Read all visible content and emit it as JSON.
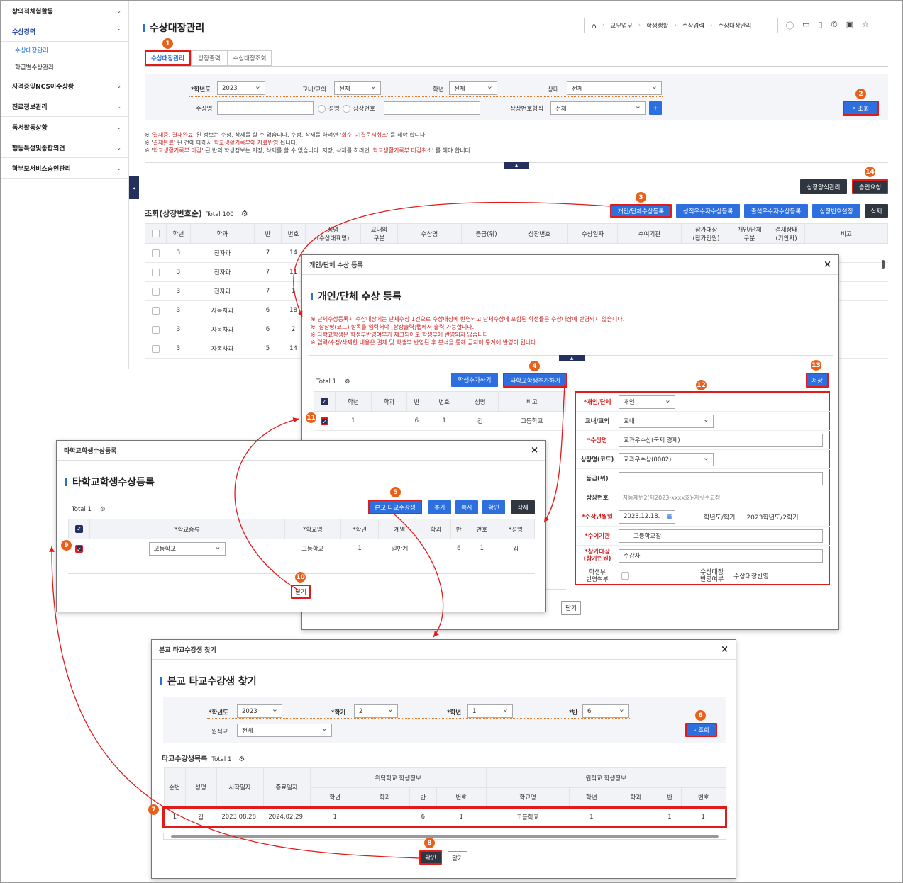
{
  "sidebar": {
    "items": [
      {
        "label": "창의적체험활동"
      },
      {
        "label": "수상경력"
      },
      {
        "label": "자격증및NCS이수상황"
      },
      {
        "label": "진로정보관리"
      },
      {
        "label": "독서활동상황"
      },
      {
        "label": "행동특성및종합의견"
      },
      {
        "label": "학부모서비스승인관리"
      }
    ],
    "subitems": [
      {
        "label": "수상대장관리"
      },
      {
        "label": "학급별수상관리"
      }
    ]
  },
  "header": {
    "title": "수상대장관리",
    "breadcrumb": [
      "교무업무",
      "학생생활",
      "수상경력",
      "수상대장관리"
    ]
  },
  "tabs": [
    {
      "label": "수상대장관리"
    },
    {
      "label": "상장출력"
    },
    {
      "label": "수상대장조회"
    }
  ],
  "search": {
    "year_label": "*학년도",
    "year": "2023",
    "inout_label": "교내/교외",
    "inout": "전체",
    "grade_label": "학년",
    "grade": "전체",
    "status_label": "상태",
    "status": "전체",
    "award_label": "수상명",
    "radio_name": "성명",
    "radio_no": "상장번호",
    "format_label": "상장번호형식",
    "format": "전체",
    "search_btn": "조회",
    "plus": "+"
  },
  "notes": [
    {
      "a": "※ '",
      "b": "결재중, 결재완료",
      "c": "' 된 정보는 수정, 삭제를 할 수 없습니다. 수정, 삭제를 하려면 '",
      "d": "회수, 기결문서취소",
      "e": "' 를 해야 합니다."
    },
    {
      "a": "※ '",
      "b": "결재완료",
      "c": "' 된 건에 대해서 ",
      "d": "학교생활기록부에 자료반영",
      "e": " 됩니다."
    },
    {
      "a": "※ '",
      "b": "학교생활기록부 마감",
      "c": "' 된 반의 학생정보는 저장, 삭제를 할 수 없습니다. 저장, 삭제를 하려면 '",
      "d": "학교생활기록부 마감취소",
      "e": "' 를 해야 합니다."
    }
  ],
  "toolbar": {
    "manage": "상장양식관리",
    "approve": "승인요청",
    "list_title": "조회(상장번호순)",
    "total": "Total 100",
    "b_indiv": "개인/단체수상등록",
    "b_grade": "성적우수자수상등록",
    "b_attend": "출석우수자수상등록",
    "b_num": "상장번호설정",
    "b_del": "삭제"
  },
  "main_table": {
    "headers": [
      "학년",
      "학과",
      "반",
      "번호",
      "성명\n(수상대표명)",
      "교내외\n구분",
      "수상명",
      "등급(위)",
      "상장번호",
      "수상일자",
      "수여기관",
      "참가대상\n(참가인원)",
      "개인/단체\n구분",
      "결재상태\n(기안자)",
      "비고"
    ],
    "rows": [
      [
        "3",
        "전자과",
        "7",
        "14"
      ],
      [
        "3",
        "전자과",
        "7",
        "11"
      ],
      [
        "3",
        "전자과",
        "7",
        "1"
      ],
      [
        "3",
        "자동차과",
        "6",
        "18"
      ],
      [
        "3",
        "자동차과",
        "6",
        "2"
      ],
      [
        "3",
        "자동차과",
        "5",
        "14"
      ]
    ]
  },
  "modal1": {
    "head": "개인/단체 수상 등록",
    "title": "개인/단체 수상 등록",
    "notes": [
      "※ 단체수상등록시 수상대장에는 단체수상 1건으로 수상대장에 반영되고 단체수상에 포함된 학생들은 수상대장에 반영되지 않습니다.",
      "※ '상장명(코드)'항목을 입력해야 [상장출력]탭에서 출력 가능합니다.",
      "※ 타학교학생은 학생부반영여부가 체크되어도 학생부에 반영되지 않습니다.",
      "※ 입력/수정/삭제한 내용은 결재 및 학생부 반영된 후 분석을 통해 금지어 통계에 반영이 됩니다."
    ],
    "total": "Total 1",
    "add_student": "학생추가하기",
    "add_other": "타학교학생추가하기",
    "save": "저장",
    "close": "닫기",
    "headers": [
      "학년",
      "학과",
      "반",
      "번호",
      "성명",
      "비고"
    ],
    "row": [
      "1",
      "",
      "6",
      "1",
      "김",
      "고등학교"
    ],
    "form": {
      "type_l": "*개인/단체",
      "type": "개인",
      "inout_l": "교내/교외",
      "inout": "교내",
      "award_l": "*수상명",
      "award": "교과우수상(국제 경제)",
      "cert_l": "상장명(코드)",
      "cert": "교과우수상(0002)",
      "grade_l": "등급(위)",
      "grade": "",
      "no_l": "상장번호",
      "no": "자동채번2(제2023-xxxx호)-자릿수고정",
      "date_l": "*수상년월일",
      "date": "2023.12.18.",
      "term_l": "학년도/학기",
      "term": "2023학년도/2학기",
      "org_l": "*수여기관",
      "org": "고등학교장",
      "target_l": "*참가대상\n(참가인원)",
      "target": "수강자",
      "rec_l": "학생부\n반영여부",
      "ledger_l": "수상대장\n반영여부",
      "ledger": "수상대장반영"
    }
  },
  "modal2": {
    "head": "타학교학생수상등록",
    "title": "타학교학생수상등록",
    "total": "Total 1",
    "b_find": "본교 타교수강생",
    "b_add": "추가",
    "b_copy": "복사",
    "b_ok": "확인",
    "b_del": "삭제",
    "close": "닫기",
    "headers": [
      "*학교종류",
      "*학교명",
      "*학년",
      "계열",
      "학과",
      "반",
      "번호",
      "*성명"
    ],
    "row": [
      "고등학교",
      "고등학교",
      "1",
      "일반계",
      "",
      "6",
      "1",
      "김"
    ]
  },
  "modal3": {
    "head": "본교 타교수강생 찾기",
    "title": "본교 타교수강생 찾기",
    "year_l": "*학년도",
    "year": "2023",
    "sem_l": "*학기",
    "sem": "2",
    "grade_l": "*학년",
    "grade": "1",
    "class_l": "*반",
    "class": "6",
    "orig_l": "원적교",
    "orig": "전체",
    "search": "조회",
    "list_title": "타교수강생목록",
    "total": "Total 1",
    "group1": "위탁학교 학생정보",
    "group2": "원적교 학생정보",
    "headers": [
      "순번",
      "성명",
      "시작일자",
      "종료일자",
      "학년",
      "학과",
      "반",
      "번호",
      "학교명",
      "학년",
      "학과",
      "반",
      "번호"
    ],
    "row": [
      "1",
      "김",
      "2023.08.28.",
      "2024.02.29.",
      "1",
      "",
      "6",
      "1",
      "고등학교",
      "1",
      "",
      "1",
      "1"
    ],
    "ok": "확인",
    "close": "닫기"
  },
  "badges": [
    "1",
    "2",
    "3",
    "4",
    "5",
    "6",
    "7",
    "8",
    "9",
    "10",
    "11",
    "12",
    "13",
    "14"
  ],
  "colors": {
    "accent": "#2e6fe0",
    "badge": "#e8601a",
    "highlight": "#e11a1a",
    "dark": "#2f3640"
  }
}
